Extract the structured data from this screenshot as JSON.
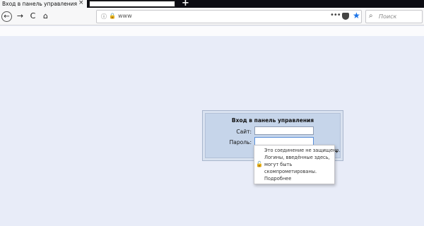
{
  "tabs": {
    "active_title": "Вход в панель управления",
    "close_glyph": "×",
    "new_tab_glyph": "+"
  },
  "nav": {
    "back_glyph": "←",
    "forward_glyph": "→",
    "reload_glyph": "C",
    "home_glyph": "⌂"
  },
  "urlbar": {
    "info_glyph": "ⓘ",
    "lock_glyph": "🔒",
    "url": "www",
    "dots": "•••",
    "star_glyph": "★"
  },
  "search": {
    "placeholder": "Поиск",
    "icon_glyph": "⌕"
  },
  "login": {
    "title": "Вход в панель управления",
    "site_label": "Сайт:",
    "password_label": "Пароль:",
    "site_value": "",
    "password_value": "",
    "arrow_glyph": "➜"
  },
  "popup": {
    "lock_glyph": "🔓",
    "lines": [
      "Это соединение не защищено.",
      "Логины, введённые здесь,",
      "могут быть",
      "скомпрометированы.",
      "Подробнее"
    ]
  },
  "colors": {
    "page_bg": "#e8ecf8",
    "panel_bg": "#c6d5ea",
    "accent_star": "#1a73e8",
    "insecure": "#b0283a"
  }
}
